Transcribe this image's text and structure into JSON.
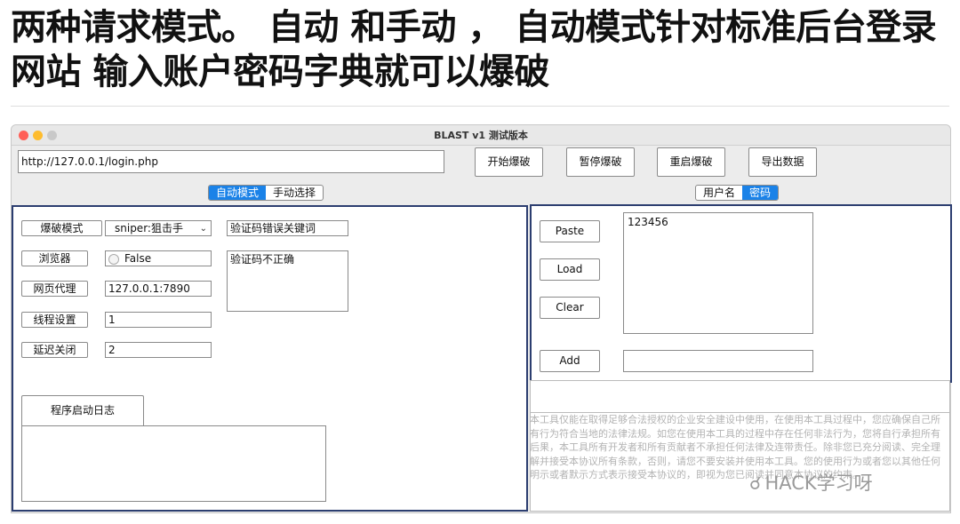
{
  "article": {
    "heading_line1": "两种请求模式。 自动 和手动 ， 自动模式针对标准后台登录",
    "heading_line2": "网站 输入账户密码字典就可以爆破"
  },
  "window": {
    "title": "BLAST v1 测试版本"
  },
  "toolbar": {
    "url_value": "http://127.0.0.1/login.php",
    "start_label": "开始爆破",
    "pause_label": "暂停爆破",
    "restart_label": "重启爆破",
    "export_label": "导出数据"
  },
  "left_tabs": [
    {
      "label": "自动模式",
      "active": true
    },
    {
      "label": "手动选择",
      "active": false
    }
  ],
  "right_tabs": [
    {
      "label": "用户名",
      "active": false
    },
    {
      "label": "密码",
      "active": true
    }
  ],
  "settings": {
    "mode_label": "爆破模式",
    "mode_value": "sniper:狙击手",
    "browser_label": "浏览器",
    "browser_value": "False",
    "proxy_label": "网页代理",
    "proxy_value": "127.0.0.1:7890",
    "threads_label": "线程设置",
    "threads_value": "1",
    "delay_label": "延迟关闭",
    "delay_value": "2",
    "captcha_keyword_label": "验证码错误关键词",
    "captcha_keyword_value": "验证码不正确",
    "log_button_label": "程序启动日志"
  },
  "dictionary": {
    "paste_label": "Paste",
    "load_label": "Load",
    "clear_label": "Clear",
    "add_label": "Add",
    "entries": "123456"
  },
  "disclaimer": "本工具仅能在取得足够合法授权的企业安全建设中使用，在使用本工具过程中，您应确保自己所有行为符合当地的法律法规。如您在使用本工具的过程中存在任何非法行为，您将自行承担所有后果，本工具所有开发者和所有贡献者不承担任何法律及连带责任。除非您已充分阅读、完全理解并接受本协议所有条款，否则，请您不要安装并使用本工具。您的使用行为或者您以其他任何明示或者默示方式表示接受本协议的，即视为您已阅读并同意本协议的约束。",
  "watermark": "HACK学习呀",
  "colors": {
    "accent": "#1a82e8",
    "panel_border": "#2c3e70",
    "window_bg": "#ececec"
  }
}
